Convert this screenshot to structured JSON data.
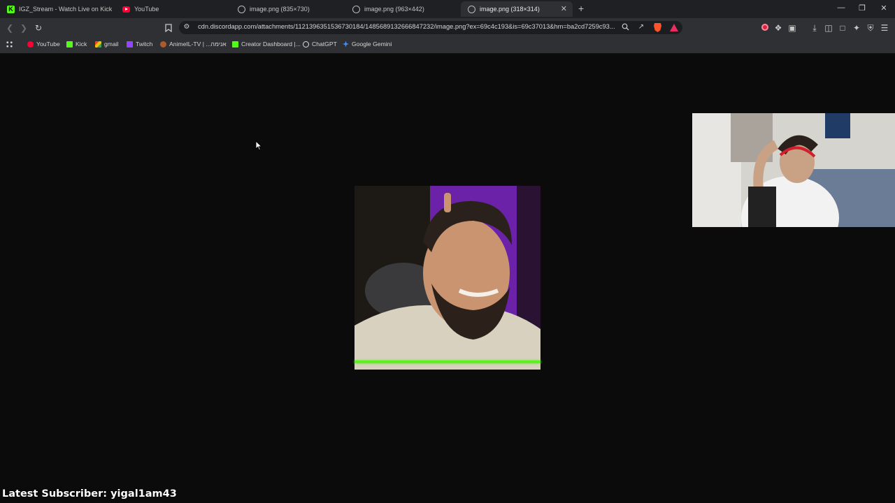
{
  "browser": {
    "tabs": [
      {
        "title": "IGZ_Stream - Watch Live on Kick",
        "favicon": "kick-icon",
        "active": false
      },
      {
        "title": "YouTube",
        "favicon": "youtube-icon",
        "active": false
      },
      {
        "title": "image.png (835×730)",
        "favicon": "globe-icon",
        "active": false
      },
      {
        "title": "image.png (963×442)",
        "favicon": "globe-icon",
        "active": false
      },
      {
        "title": "image.png (318×314)",
        "favicon": "globe-icon",
        "active": true
      }
    ],
    "new_tab_glyph": "+",
    "tab_close_glyph": "✕",
    "window_controls": {
      "minimize": "—",
      "restore": "❐",
      "close": "✕"
    },
    "address": {
      "url": "cdn.discordapp.com/attachments/1121396351536730184/1485689132666847232/image.png?ex=69c4c193&is=69c37013&hm=ba2cd7259c93..."
    },
    "bookmarks": [
      {
        "label": "YouTube",
        "icon": "youtube-icon"
      },
      {
        "label": "Kick",
        "icon": "kick-icon"
      },
      {
        "label": "gmail",
        "icon": "gmail-icon"
      },
      {
        "label": "Twitch",
        "icon": "twitch-icon"
      },
      {
        "label": "AnimeIL-TV | ...אנימה",
        "icon": "animeil-icon"
      },
      {
        "label": "Creator Dashboard |...",
        "icon": "kick-icon"
      },
      {
        "label": "ChatGPT",
        "icon": "chatgpt-icon"
      },
      {
        "label": "Google Gemini",
        "icon": "gemini-icon"
      }
    ],
    "colors": {
      "tab_strip": "#1f2023",
      "toolbar": "#2e3033",
      "page_background": "#0b0b0b",
      "kick_green": "#53fc18",
      "brave_orange": "#fb542b"
    }
  },
  "content": {
    "image_progress_fraction": 1.0,
    "progress_color": "#5ef021"
  },
  "overlay": {
    "latest_subscriber": "Latest Subscriber: yigal1am43"
  }
}
